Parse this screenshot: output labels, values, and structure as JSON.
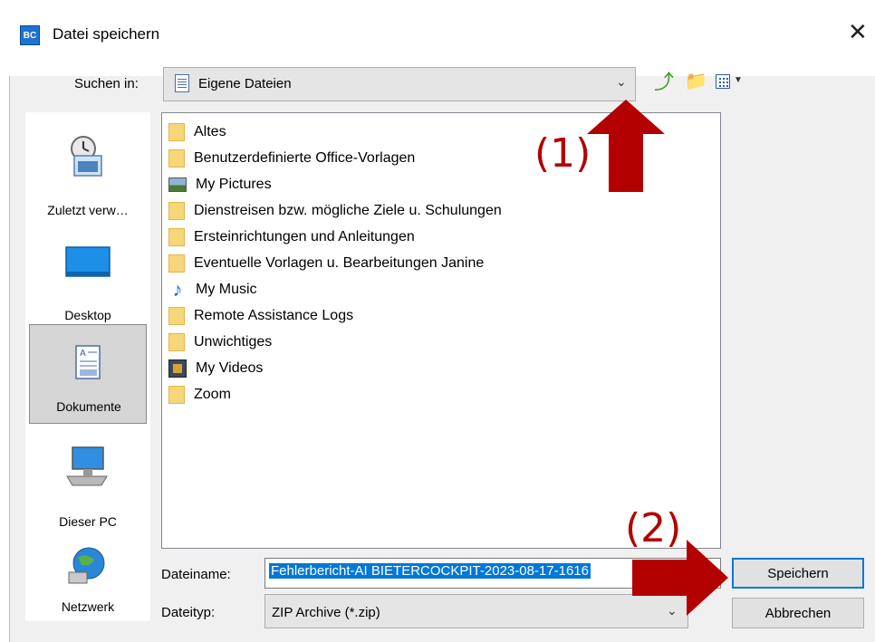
{
  "window": {
    "title": "Datei speichern",
    "icon_text": "BC"
  },
  "lookin": {
    "label": "Suchen in:",
    "value": "Eigene Dateien"
  },
  "places": [
    {
      "label": "Zuletzt verw…",
      "icon": "recent-icon"
    },
    {
      "label": "Desktop",
      "icon": "desktop-icon"
    },
    {
      "label": "Dokumente",
      "icon": "documents-icon",
      "selected": true
    },
    {
      "label": "Dieser PC",
      "icon": "computer-icon"
    },
    {
      "label": "Netzwerk",
      "icon": "network-icon"
    }
  ],
  "files": [
    {
      "name": "Altes",
      "icon": "folder"
    },
    {
      "name": "Benutzerdefinierte Office-Vorlagen",
      "icon": "folder"
    },
    {
      "name": "My Pictures",
      "icon": "pictures"
    },
    {
      "name": "Dienstreisen bzw. mögliche Ziele u. Schulungen",
      "icon": "folder"
    },
    {
      "name": "Ersteinrichtungen und Anleitungen",
      "icon": "folder"
    },
    {
      "name": "Eventuelle Vorlagen u. Bearbeitungen Janine",
      "icon": "folder"
    },
    {
      "name": "My Music",
      "icon": "music"
    },
    {
      "name": "Remote Assistance Logs",
      "icon": "folder"
    },
    {
      "name": "Unwichtiges",
      "icon": "folder"
    },
    {
      "name": "My Videos",
      "icon": "videos"
    },
    {
      "name": "Zoom",
      "icon": "folder"
    }
  ],
  "filename": {
    "label": "Dateiname:",
    "value": "Fehlerbericht-AI BIETERCOCKPIT-2023-08-17-1616"
  },
  "filetype": {
    "label": "Dateityp:",
    "value": "ZIP Archive (*.zip)"
  },
  "buttons": {
    "save": "Speichern",
    "cancel": "Abbrechen"
  },
  "annotations": {
    "one": "(1)",
    "two": "(2)",
    "color": "#b30000"
  }
}
